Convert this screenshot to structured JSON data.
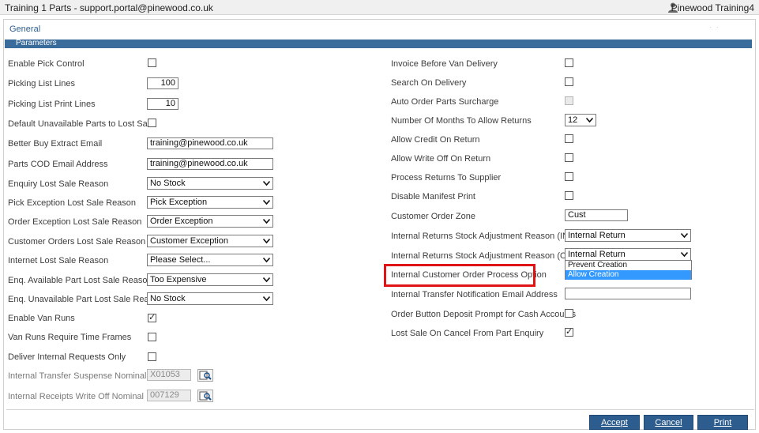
{
  "titlebar": {
    "title": "Training 1 Parts - support.portal@pinewood.co.uk",
    "user": "Pinewood Training4"
  },
  "tab": "General",
  "section": "Parameters",
  "left": {
    "enable_pick_control": {
      "label": "Enable Pick Control",
      "checked": false
    },
    "picking_list_lines": {
      "label": "Picking List Lines",
      "value": "100"
    },
    "picking_list_print_lines": {
      "label": "Picking List Print Lines",
      "value": "10"
    },
    "default_unavailable": {
      "label": "Default Unavailable Parts to Lost Sale",
      "checked": false
    },
    "better_buy_email": {
      "label": "Better Buy Extract Email",
      "value": "training@pinewood.co.uk"
    },
    "parts_cod_email": {
      "label": "Parts COD Email Address",
      "value": "training@pinewood.co.uk"
    },
    "enquiry_lost_sale": {
      "label": "Enquiry Lost Sale Reason",
      "value": "No Stock"
    },
    "pick_exception": {
      "label": "Pick Exception Lost Sale Reason",
      "value": "Pick Exception"
    },
    "order_exception": {
      "label": "Order Exception Lost Sale Reason",
      "value": "Order Exception"
    },
    "customer_orders": {
      "label": "Customer Orders Lost Sale Reason",
      "value": "Customer Exception"
    },
    "internet_lost_sale": {
      "label": "Internet Lost Sale Reason",
      "value": "Please Select..."
    },
    "enq_available": {
      "label": "Enq. Available Part Lost Sale Reason",
      "value": "Too Expensive"
    },
    "enq_unavailable": {
      "label": "Enq. Unavailable Part Lost Sale Reason",
      "value": "No Stock"
    },
    "enable_van_runs": {
      "label": "Enable Van Runs",
      "checked": true
    },
    "van_runs_time": {
      "label": "Van Runs Require Time Frames",
      "checked": false
    },
    "deliver_internal": {
      "label": "Deliver Internal Requests Only",
      "checked": false
    },
    "transfer_suspense": {
      "label": "Internal Transfer Suspense Nominal",
      "value": "X01053"
    },
    "receipts_write_off": {
      "label": "Internal Receipts Write Off Nominal",
      "value": "007129"
    }
  },
  "right": {
    "invoice_before_van": {
      "label": "Invoice Before Van Delivery",
      "checked": false
    },
    "search_on_delivery": {
      "label": "Search On Delivery",
      "checked": false
    },
    "auto_order_surcharge": {
      "label": "Auto Order Parts Surcharge",
      "checked": false
    },
    "months_returns": {
      "label": "Number Of Months To Allow Returns",
      "value": "12"
    },
    "allow_credit": {
      "label": "Allow Credit On Return",
      "checked": false
    },
    "allow_write_off": {
      "label": "Allow Write Off On Return",
      "checked": false
    },
    "process_returns": {
      "label": "Process Returns To Supplier",
      "checked": false
    },
    "disable_manifest": {
      "label": "Disable Manifest Print",
      "checked": false
    },
    "customer_order_zone": {
      "label": "Customer Order Zone",
      "value": "Cust"
    },
    "returns_in": {
      "label": "Internal Returns Stock Adjustment Reason (IN)",
      "value": "Internal Return"
    },
    "returns_out": {
      "label": "Internal Returns Stock Adjustment Reason (OUT)",
      "value": "Internal Return"
    },
    "process_option": {
      "label": "Internal Customer Order Process Option",
      "options": [
        "Prevent Creation",
        "Allow Creation"
      ],
      "selected": "Allow Creation"
    },
    "transfer_email": {
      "label": "Internal Transfer Notification Email Address",
      "value": ""
    },
    "deposit_prompt": {
      "label": "Order Button Deposit Prompt for Cash Accounts",
      "checked": false
    },
    "lost_sale_cancel": {
      "label": "Lost Sale On Cancel From Part Enquiry",
      "checked": true
    }
  },
  "buttons": {
    "accept": "Accept",
    "cancel": "Cancel",
    "print": "Print"
  },
  "colors": {
    "accent": "#2d5c8e",
    "section": "#3a6c9b",
    "highlight": "#e01414",
    "selection": "#3399ff"
  }
}
